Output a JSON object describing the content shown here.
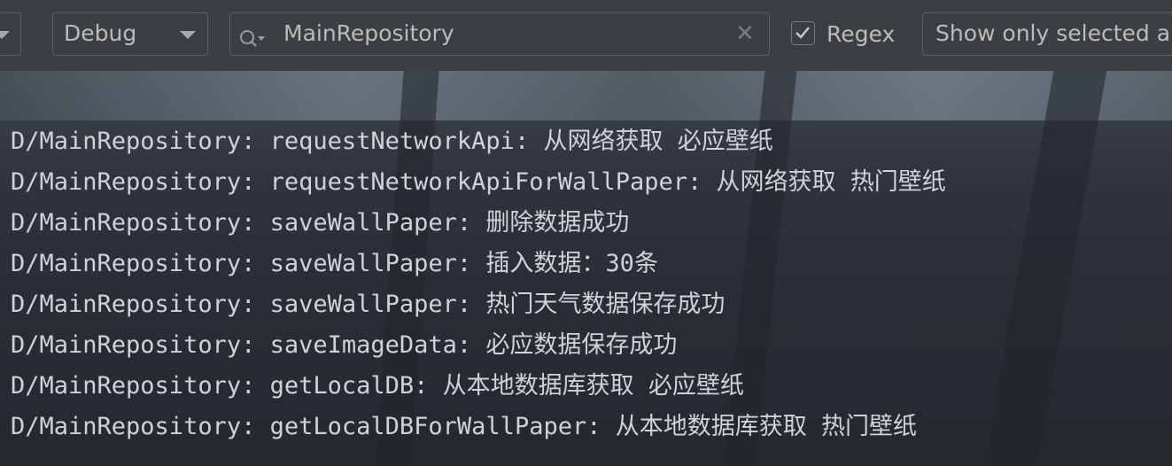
{
  "toolbar": {
    "log_level": "Debug",
    "search": {
      "value": "MainRepository",
      "search_icon": "search-icon",
      "clear_icon": "close-icon"
    },
    "regex": {
      "label": "Regex",
      "checked": true
    },
    "filter_select": "Show only selected app"
  },
  "log": {
    "lines": [
      "D/MainRepository: requestNetworkApi: 从网络获取 必应壁纸",
      "D/MainRepository: requestNetworkApiForWallPaper: 从网络获取 热门壁纸",
      "D/MainRepository: saveWallPaper: 删除数据成功",
      "D/MainRepository: saveWallPaper: 插入数据：30条",
      "D/MainRepository: saveWallPaper: 热门天气数据保存成功",
      "D/MainRepository: saveImageData: 必应数据保存成功",
      "D/MainRepository: getLocalDB: 从本地数据库获取 必应壁纸",
      "D/MainRepository: getLocalDBForWallPaper: 从本地数据库获取 热门壁纸"
    ]
  },
  "colors": {
    "toolbar_bg": "#3c3f41",
    "control_border": "#5e6163",
    "text": "#bbbbbb",
    "log_text": "#d0d2d5"
  }
}
